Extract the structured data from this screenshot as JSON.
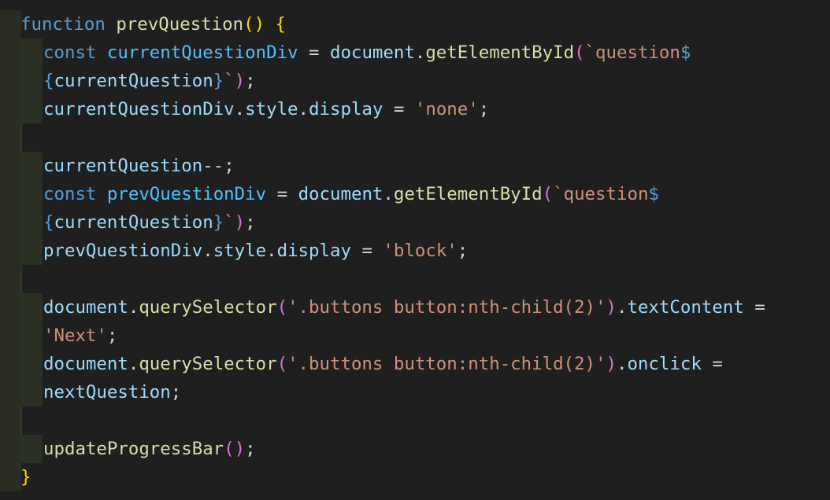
{
  "code": {
    "l1": {
      "kw": "function",
      "fn": "prevQuestion",
      "paren": "()",
      "brace": "{"
    },
    "l2": {
      "kw": "const",
      "var": "currentQuestionDiv",
      "eq": "=",
      "doc": "document",
      "dot": ".",
      "fn": "getElementById",
      "paren": "(",
      "str": "`question",
      "dollar": "$"
    },
    "l3": {
      "open": "{",
      "var": "currentQuestion",
      "close": "}",
      "tick": "`",
      "paren": ")",
      "semi": ";"
    },
    "l4": {
      "var": "currentQuestionDiv",
      "dot1": ".",
      "style": "style",
      "dot2": ".",
      "display": "display",
      "eq": "=",
      "str": "'none'",
      "semi": ";"
    },
    "l6": {
      "var": "currentQuestion",
      "op": "--",
      "semi": ";"
    },
    "l7": {
      "kw": "const",
      "var": "prevQuestionDiv",
      "eq": "=",
      "doc": "document",
      "dot": ".",
      "fn": "getElementById",
      "paren": "(",
      "str": "`question",
      "dollar": "$"
    },
    "l8": {
      "open": "{",
      "var": "currentQuestion",
      "close": "}",
      "tick": "`",
      "paren": ")",
      "semi": ";"
    },
    "l9": {
      "var": "prevQuestionDiv",
      "dot1": ".",
      "style": "style",
      "dot2": ".",
      "display": "display",
      "eq": "=",
      "str": "'block'",
      "semi": ";"
    },
    "l11": {
      "doc": "document",
      "dot": ".",
      "fn": "querySelector",
      "paren": "(",
      "str": "'.buttons button:nth-child(2)'",
      "close": ")",
      "dot2": ".",
      "prop": "textContent",
      "eq": "="
    },
    "l12": {
      "str": "'Next'",
      "semi": ";"
    },
    "l13": {
      "doc": "document",
      "dot": ".",
      "fn": "querySelector",
      "paren": "(",
      "str": "'.buttons button:nth-child(2)'",
      "close": ")",
      "dot2": ".",
      "prop": "onclick",
      "eq": "="
    },
    "l14": {
      "var": "nextQuestion",
      "semi": ";"
    },
    "l16": {
      "fn": "updateProgressBar",
      "paren": "()",
      "semi": ";"
    },
    "l17": {
      "brace": "}"
    }
  },
  "colors": {
    "background": "#1f1f1f",
    "keyword": "#569cd6",
    "function": "#dcdcaa",
    "variable": "#9cdcfe",
    "constant": "#4fc1ff",
    "string": "#ce9178",
    "bracket_level1": "#ffd700",
    "bracket_level2": "#da70d6",
    "bracket_level3": "#179fff"
  }
}
